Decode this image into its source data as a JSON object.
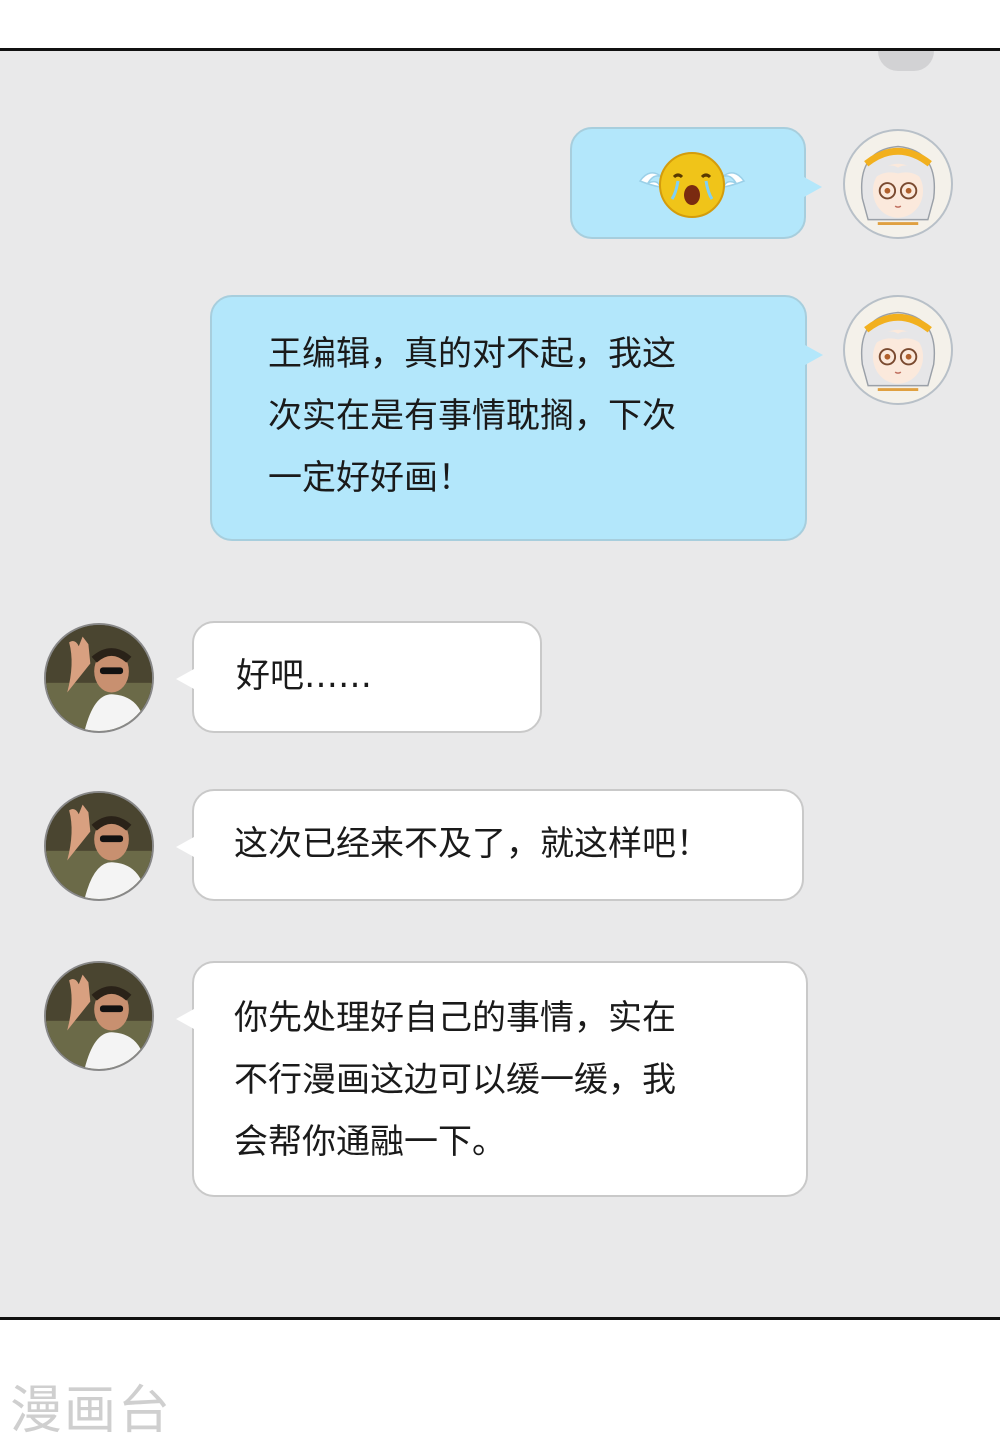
{
  "chat": {
    "messages": [
      {
        "sender": "me",
        "type": "emoji",
        "emoji": "crying-face-icon"
      },
      {
        "sender": "me",
        "type": "text",
        "text": "王编辑，真的对不起，我这\n次实在是有事情耽搁，下次\n一定好好画！"
      },
      {
        "sender": "editor",
        "type": "text",
        "text": "好吧……"
      },
      {
        "sender": "editor",
        "type": "text",
        "text": "这次已经来不及了，就这样吧！"
      },
      {
        "sender": "editor",
        "type": "text",
        "text": "你先处理好自己的事情，实在\n不行漫画这边可以缓一缓，我\n会帮你通融一下。"
      }
    ]
  },
  "colors": {
    "background": "#e9e9ea",
    "my_bubble": "#b3e7fb",
    "their_bubble": "#ffffff"
  },
  "watermark": "漫画台"
}
